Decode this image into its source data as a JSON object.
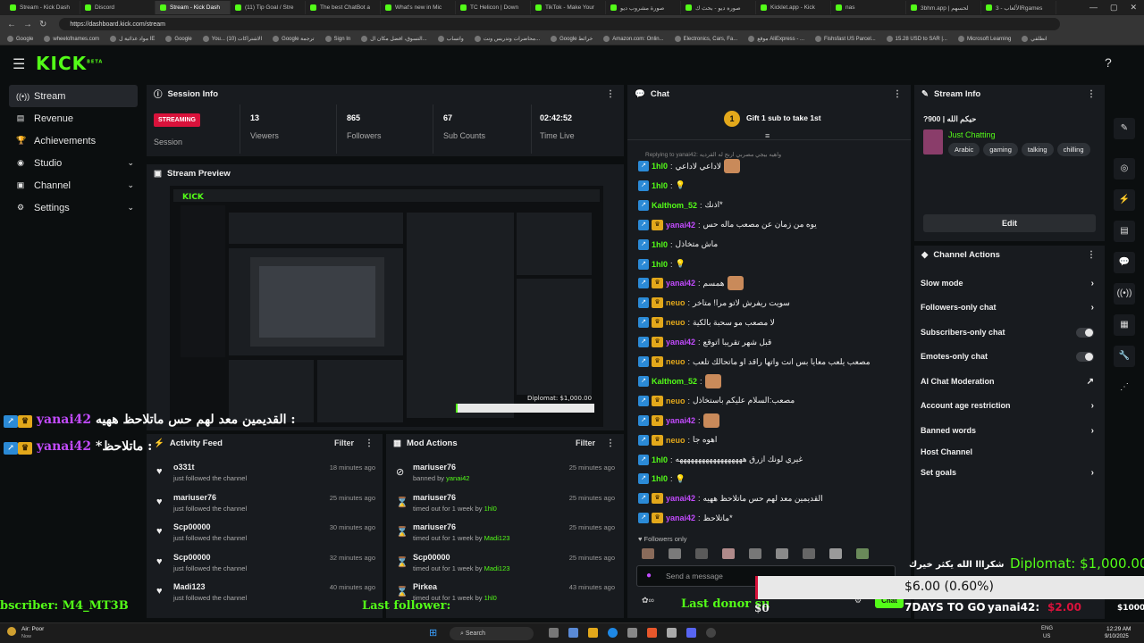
{
  "browser": {
    "tabs": [
      "Stream - Kick Dash",
      "Discord",
      "Stream - Kick Dash",
      "(11) Tip Goal / Stre",
      "The best ChatBot a",
      "What's new in Mic",
      "TC Helicon | Down",
      "TikTok - Make Your",
      "صورة مشروب ديو",
      "صوره ديو - بحث ك",
      "Kicklet.app - Kick",
      "nas",
      "3bhm.app | لحسهم",
      "الألعاب - 3Rgames"
    ],
    "url": "https://dashboard.kick.com/stream",
    "bookmarks": [
      "Google",
      "wheelofnames.com",
      "مواد غذائية ل IE",
      "Google",
      "You... (10) الاشتراكات",
      "Google ترجمة",
      "Sign In",
      "التسوق، افضل مكان ال...",
      "واتساب",
      "محاضرات وتدريس ونت...",
      "Google خرائط",
      "Amazon.com: Onlin...",
      "Electronics, Cars, Fa...",
      "موقع AliExpress - ...",
      "Fishsfast US Parcel...",
      "15.28 USD to SAR |...",
      "Microsoft Learning",
      "انطلقي"
    ]
  },
  "header": {
    "logo": "KICK",
    "logo_sup": "BETA"
  },
  "sidebar": {
    "items": [
      {
        "label": "Stream",
        "icon": "broadcast-icon",
        "glyph": "((•))"
      },
      {
        "label": "Revenue",
        "icon": "revenue-icon",
        "glyph": "▤"
      },
      {
        "label": "Achievements",
        "icon": "trophy-icon",
        "glyph": "🏆"
      },
      {
        "label": "Studio",
        "icon": "studio-icon",
        "glyph": "◉",
        "chevron": "⌄"
      },
      {
        "label": "Channel",
        "icon": "channel-icon",
        "glyph": "▣",
        "chevron": "⌄"
      },
      {
        "label": "Settings",
        "icon": "gear-icon",
        "glyph": "⚙",
        "chevron": "⌄"
      }
    ]
  },
  "session": {
    "title": "Session Info",
    "badge": "STREAMING",
    "badge_label": "Session",
    "stats": [
      {
        "value": "13",
        "label": "Viewers"
      },
      {
        "value": "865",
        "label": "Followers"
      },
      {
        "value": "67",
        "label": "Sub Counts"
      },
      {
        "value": "02:42:52",
        "label": "Time Live"
      }
    ]
  },
  "preview": {
    "title": "Stream Preview"
  },
  "activity": {
    "title": "Activity Feed",
    "filter": "Filter",
    "rows": [
      {
        "name": "o331t",
        "sub": "just followed the channel",
        "time": "18 minutes ago"
      },
      {
        "name": "mariuser76",
        "sub": "just followed the channel",
        "time": "25 minutes ago"
      },
      {
        "name": "Scp00000",
        "sub": "just followed the channel",
        "time": "30 minutes ago"
      },
      {
        "name": "Scp00000",
        "sub": "just followed the channel",
        "time": "32 minutes ago"
      },
      {
        "name": "Madi123",
        "sub": "just followed the channel",
        "time": "40 minutes ago"
      }
    ]
  },
  "mod": {
    "title": "Mod Actions",
    "filter": "Filter",
    "rows": [
      {
        "name": "mariuser76",
        "sub": "banned by",
        "by": "yanai42",
        "time": "25 minutes ago",
        "icon": "ban-icon",
        "glyph": "⊘"
      },
      {
        "name": "mariuser76",
        "sub": "timed out for 1 week by",
        "by": "1hl0",
        "time": "25 minutes ago",
        "icon": "hourglass-icon",
        "glyph": "⌛"
      },
      {
        "name": "mariuser76",
        "sub": "timed out for 1 week by",
        "by": "Madi123",
        "time": "25 minutes ago",
        "icon": "hourglass-icon",
        "glyph": "⌛"
      },
      {
        "name": "Scp00000",
        "sub": "timed out for 1 week by",
        "by": "Madi123",
        "time": "25 minutes ago",
        "icon": "hourglass-icon",
        "glyph": "⌛"
      },
      {
        "name": "Pirkea",
        "sub": "timed out for 1 week by",
        "by": "1hl0",
        "time": "43 minutes ago",
        "icon": "hourglass-icon",
        "glyph": "⌛"
      }
    ]
  },
  "chat": {
    "title": "Chat",
    "pinned": "Gift 1 sub to take 1st",
    "pinned_rank": "1",
    "replying": "Replying to yanai42: واهيه بيجي مصربي ارنج له القرديه",
    "messages": [
      {
        "user": "1hl0",
        "color": "#53fc18",
        "crown": false,
        "text": "لاداعي لاداعي",
        "emote": true
      },
      {
        "user": "1hl0",
        "color": "#53fc18",
        "crown": false,
        "text": "💡",
        "emote": false
      },
      {
        "user": "Kalthom_52",
        "color": "#53fc18",
        "crown": false,
        "text": "*اذنك",
        "emote": false
      },
      {
        "user": "yanai42",
        "color": "#c34bff",
        "crown": true,
        "text": "يوه من زمان عن مصعب ماله حس",
        "emote": false
      },
      {
        "user": "1hl0",
        "color": "#53fc18",
        "crown": false,
        "text": "ماش متخاذل",
        "emote": false
      },
      {
        "user": "1hl0",
        "color": "#53fc18",
        "crown": false,
        "text": "💡",
        "emote": false
      },
      {
        "user": "yanai42",
        "color": "#c34bff",
        "crown": true,
        "text": "همسم",
        "emote": true
      },
      {
        "user": "neuo",
        "color": "#e3a81b",
        "crown": true,
        "text": "سويت ريفرش لاتو مرا! متاخر",
        "emote": false
      },
      {
        "user": "neuo",
        "color": "#e3a81b",
        "crown": true,
        "text": "لا مصعب مو سحبة بالكية",
        "emote": false
      },
      {
        "user": "yanai42",
        "color": "#c34bff",
        "crown": true,
        "text": "قبل شهر تقريبا اتوقع",
        "emote": false
      },
      {
        "user": "neuo",
        "color": "#e3a81b",
        "crown": true,
        "text": "مصعب يلعب معايا بس انت واتها راقد او ماتحالك تلعب",
        "emote": false
      },
      {
        "user": "Kalthom_52",
        "color": "#53fc18",
        "crown": false,
        "text": "",
        "emote": true
      },
      {
        "user": "neuo",
        "color": "#e3a81b",
        "crown": true,
        "text": "مصعب:السلام عليكم باستخاذل",
        "emote": false
      },
      {
        "user": "yanai42",
        "color": "#c34bff",
        "crown": true,
        "text": "",
        "emote": true
      },
      {
        "user": "neuo",
        "color": "#e3a81b",
        "crown": true,
        "text": "اهوه جا",
        "emote": false
      },
      {
        "user": "1hl0",
        "color": "#53fc18",
        "crown": false,
        "text": "غيري لونك ازرق ههههههههههههههههههه",
        "emote": false
      },
      {
        "user": "1hl0",
        "color": "#53fc18",
        "crown": false,
        "text": "💡",
        "emote": false
      },
      {
        "user": "yanai42",
        "color": "#c34bff",
        "crown": true,
        "text": "القديمين معد لهم حس ماتلاحظ ههيه",
        "emote": false
      },
      {
        "user": "yanai42",
        "color": "#c34bff",
        "crown": true,
        "text": "*ماتلاحظ",
        "emote": false
      }
    ],
    "followers_only": "Followers only",
    "input_placeholder": "Send a message",
    "send_label": "Chat"
  },
  "stream_info": {
    "title": "Stream Info",
    "stream_title": "?900 | حيكم الله",
    "category": "Just Chatting",
    "tags": [
      "Arabic",
      "gaming",
      "talking",
      "chilling"
    ],
    "edit": "Edit"
  },
  "channel_actions": {
    "title": "Channel Actions",
    "items": [
      {
        "label": "Slow mode",
        "control": "chevron"
      },
      {
        "label": "Followers-only chat",
        "control": "chevron"
      },
      {
        "label": "Subscribers-only chat",
        "control": "toggle"
      },
      {
        "label": "Emotes-only chat",
        "control": "toggle"
      },
      {
        "label": "AI Chat Moderation",
        "control": "external"
      },
      {
        "label": "Account age restriction",
        "control": "chevron"
      },
      {
        "label": "Banned words",
        "control": "chevron"
      },
      {
        "label": "Host Channel",
        "control": "none"
      },
      {
        "label": "Set goals",
        "control": "chevron"
      }
    ]
  },
  "overlays": {
    "chat1_user": "yanai42",
    "chat1_text": "القديمين معد لهم حس ماتلاحظ ههيه :",
    "chat2_user": "yanai42",
    "chat2_text": "*ماتلاحظ :",
    "subscriber": "bscriber: M4_MT3B",
    "last_follower": "Last follower:",
    "last_donor": "Last donor su",
    "donor_amount": "$0",
    "thanks": "شكرااا الله يكثر خيرك",
    "diplomat": "Diplomat: $1,000.00",
    "goal_amount": "$6.00 (0.60%)",
    "days_to_go": "7DAYS TO GO",
    "top_user": "yanai42:",
    "top_amount": "$2.00",
    "goal_end": "$1000",
    "goal_progress": 0.006
  },
  "taskbar": {
    "weather": "Air: Poor",
    "weather_sub": "Now",
    "search": "Search",
    "lang": "ENG",
    "region": "US",
    "time": "12:29 AM",
    "date": "9/10/2025"
  },
  "colors": {
    "accent": "#53fc18",
    "live": "#d9123b",
    "purple": "#c34bff",
    "gold": "#e3a81b"
  }
}
